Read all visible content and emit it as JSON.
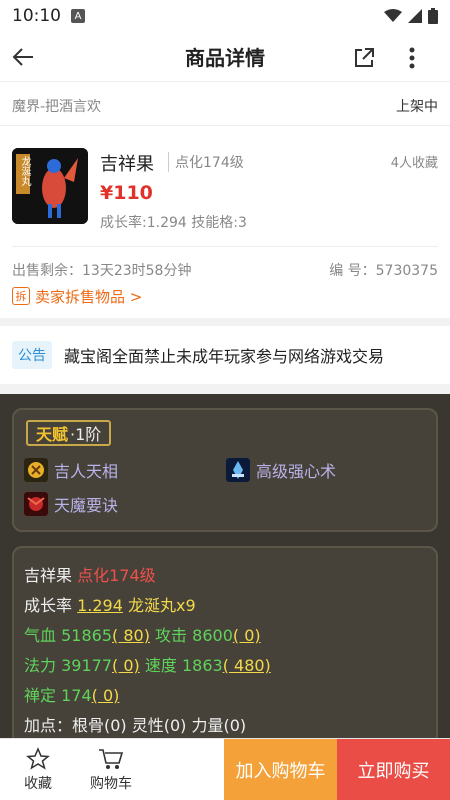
{
  "status_bar": {
    "time": "10:10",
    "a_icon": "A"
  },
  "header": {
    "title": "商品详情"
  },
  "seller": {
    "server": "魔界-把酒言欢",
    "status": "上架中"
  },
  "product": {
    "name": "吉祥果",
    "level": "点化174级",
    "favorites": "4人收藏",
    "price": "¥110",
    "growth": "成长率:1.294 技能格:3",
    "thumb_label": "龙涎丸"
  },
  "meta": {
    "remaining": "出售剩余：13天23时58分钟",
    "code": "编 号：5730375"
  },
  "split_link": {
    "tag": "拆",
    "label": "卖家拆售物品 >"
  },
  "notice": {
    "badge": "公告",
    "text": "藏宝阁全面禁止未成年玩家参与网络游戏交易"
  },
  "talent": {
    "title_main": "天赋",
    "title_rank": "·1阶",
    "skills": [
      {
        "name": "吉人天相",
        "icon": "fortune-skill-icon"
      },
      {
        "name": "高级强心术",
        "icon": "heart-skill-icon"
      },
      {
        "name": "天魔要诀",
        "icon": "demon-skill-icon"
      }
    ]
  },
  "stats": {
    "name": "吉祥果",
    "level": "点化174级",
    "growth_label": "成长率",
    "growth_value": "1.294",
    "pill": "龙涎丸x9",
    "hp_label": "气血",
    "hp_value": "51865",
    "hp_bonus": "( 80)",
    "atk_label": "攻击",
    "atk_value": "8600",
    "atk_bonus": "( 0)",
    "mp_label": "法力",
    "mp_value": "39177",
    "mp_bonus": "( 0)",
    "spd_label": "速度",
    "spd_value": "1863",
    "spd_bonus": "( 480)",
    "calm_label": "禅定",
    "calm_value": "174",
    "calm_bonus": "( 0)",
    "points_line": "加点：根骨(0) 灵性(0) 力量(0)"
  },
  "bottom": {
    "fav_label": "收藏",
    "cart_label": "购物车",
    "add_cart": "加入购物车",
    "buy_now": "立即购买"
  },
  "colors": {
    "price": "#e0312a",
    "accent_orange": "#f4a13a",
    "accent_red": "#ea4d45",
    "link_orange": "#ee6a14"
  }
}
